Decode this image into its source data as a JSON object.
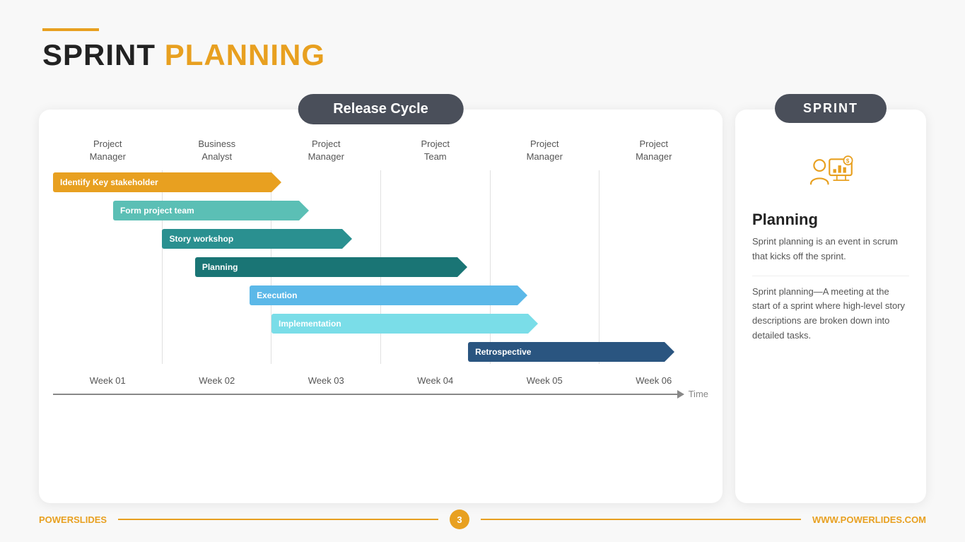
{
  "header": {
    "line_color": "#E8A020",
    "title_black": "SPRINT",
    "title_orange": "PLANNING"
  },
  "gantt": {
    "badge": "Release Cycle",
    "columns": [
      {
        "label": "Project\nManager"
      },
      {
        "label": "Business\nAnalyst"
      },
      {
        "label": "Project\nManager"
      },
      {
        "label": "Project\nTeam"
      },
      {
        "label": "Project\nManager"
      },
      {
        "label": "Project\nManager"
      }
    ],
    "bars": [
      {
        "label": "Identify Key stakeholder",
        "color": "#E8A020",
        "arrow_color": "#E8A020",
        "start": 0,
        "span": 2.1
      },
      {
        "label": "Form project team",
        "color": "#5bbfb5",
        "arrow_color": "#5bbfb5",
        "start": 0.5,
        "span": 1.8
      },
      {
        "label": "Story workshop",
        "color": "#2a9090",
        "arrow_color": "#2a9090",
        "start": 1,
        "span": 1.8
      },
      {
        "label": "Planning",
        "color": "#1a7575",
        "arrow_color": "#1a7575",
        "start": 1.3,
        "span": 2.5
      },
      {
        "label": "Execution",
        "color": "#5bb8e8",
        "arrow_color": "#5bb8e8",
        "start": 1.8,
        "span": 2.5
      },
      {
        "label": "Implementation",
        "color": "#7dd8e8",
        "arrow_color": "#7dd8e8",
        "start": 2.0,
        "span": 2.4
      },
      {
        "label": "Retrospective",
        "color": "#2a5580",
        "arrow_color": "#2a5580",
        "start": 3.8,
        "span": 1.8
      }
    ],
    "weeks": [
      "Week 01",
      "Week 02",
      "Week 03",
      "Week 04",
      "Week 05",
      "Week 06"
    ],
    "timeline_label": "Time"
  },
  "sprint": {
    "badge": "SPRINT",
    "icon_color": "#E8A020",
    "planning_title": "Planning",
    "text1": "Sprint planning is an event in scrum that kicks off the sprint.",
    "text2": "Sprint planning—A meeting at the start of a sprint where high-level story descriptions are broken down into detailed tasks."
  },
  "footer": {
    "brand_black": "POWER",
    "brand_orange": "SLIDES",
    "page_number": "3",
    "url": "WWW.POWERLIDES.COM"
  }
}
